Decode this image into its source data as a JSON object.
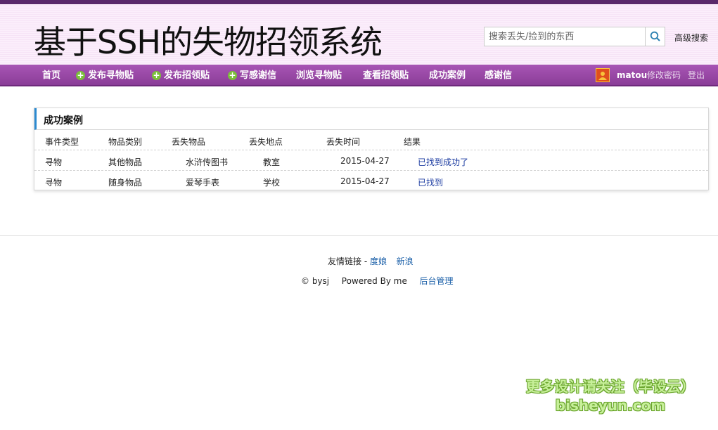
{
  "header": {
    "site_title": "基于SSH的失物招领系统",
    "search_placeholder": "搜索丢失/捡到的东西",
    "advanced_search": "高级搜索"
  },
  "nav": {
    "items": [
      {
        "label": "首页",
        "icon": ""
      },
      {
        "label": "发布寻物贴",
        "icon": "plus-circle-icon"
      },
      {
        "label": "发布招领贴",
        "icon": "plus-circle-icon"
      },
      {
        "label": "写感谢信",
        "icon": "plus-circle-icon"
      },
      {
        "label": "浏览寻物贴",
        "icon": ""
      },
      {
        "label": "查看招领贴",
        "icon": ""
      },
      {
        "label": "成功案例",
        "icon": ""
      },
      {
        "label": "感谢信",
        "icon": ""
      }
    ],
    "username": "matou",
    "change_password": "修改密码",
    "logout": "登出"
  },
  "panel": {
    "title": "成功案例",
    "columns": [
      "事件类型",
      "物品类别",
      "丢失物品",
      "丢失地点",
      "丢失时间",
      "结果"
    ],
    "rows": [
      [
        "寻物",
        "其他物品",
        "水浒传图书",
        "教室",
        "2015-04-27",
        "已找到成功了"
      ],
      [
        "寻物",
        "随身物品",
        "爱琴手表",
        "学校",
        "2015-04-27",
        "已找到"
      ]
    ]
  },
  "footer": {
    "friend_links_label": "友情链接 - ",
    "links": [
      "度娘",
      "新浪"
    ],
    "copyright": "© bysj",
    "powered_by": "Powered By me",
    "admin_link": "后台管理"
  },
  "watermark": {
    "line1": "更多设计请关注（毕设云）",
    "line2": "bisheyun.com"
  },
  "colors": {
    "nav_bg": "#9a48a8",
    "panel_accent": "#2b8ad0",
    "link": "#1a5fa8"
  }
}
